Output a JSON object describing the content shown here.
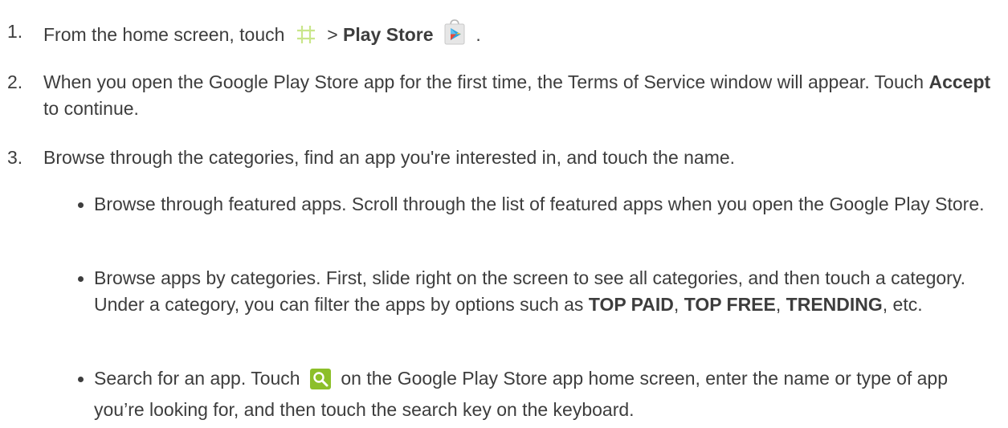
{
  "steps": [
    {
      "num": "1.",
      "pre": "From the home screen, touch",
      "sep": ">",
      "bold": "Play Store",
      "post": ".",
      "icons": [
        "apps-grid-icon",
        "play-store-icon"
      ]
    },
    {
      "num": "2.",
      "pre": "When you open the Google Play Store app for the first time, the Terms of Service window will appear. Touch",
      "bold": "Accept",
      "post": "to continue."
    },
    {
      "num": "3.",
      "text": "Browse through the categories, find an app you're interested in, and touch the name."
    }
  ],
  "bullets": [
    {
      "text": "Browse through featured apps. Scroll through the list of featured apps when you open the Google Play Store."
    },
    {
      "pre": "Browse apps by categories. First, slide right on the screen to see all categories, and then touch a category. Under a category, you can filter the apps by options such as",
      "bold1": "TOP PAID",
      "sep1": ",",
      "bold2": "TOP FREE",
      "sep2": ",",
      "bold3": "TRENDING",
      "post": ", etc."
    },
    {
      "pre": "Search for an app. Touch",
      "icon": "search-icon",
      "post": "on the Google Play Store app home screen, enter the name or type of app you’re looking for, and then touch the search key on the keyboard."
    }
  ]
}
